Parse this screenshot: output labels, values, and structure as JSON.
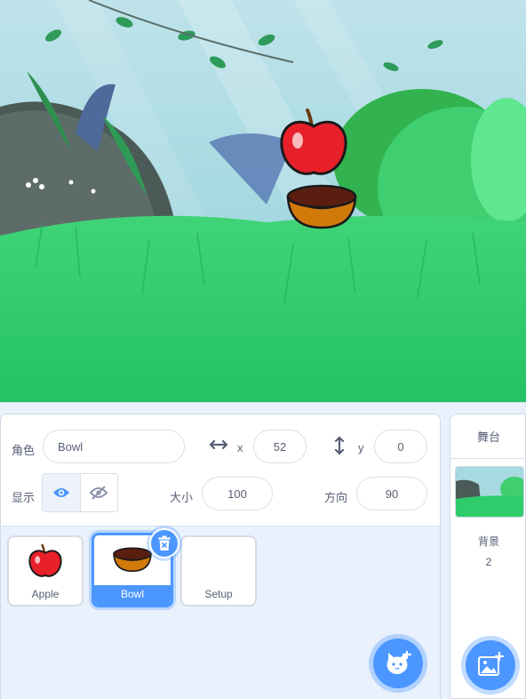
{
  "colors": {
    "accent": "#4c97ff",
    "text": "#575e75",
    "pane_bg": "#e9f1fc",
    "grass": "#2ecc6a",
    "apple_red": "#e8202a",
    "bowl_orange": "#d17a0a"
  },
  "stage": {
    "scene": "forest-grass-backdrop"
  },
  "sprite_info": {
    "sprite_label": "角色",
    "sprite_name": "Bowl",
    "x_label": "x",
    "x_value": "52",
    "y_label": "y",
    "y_value": "0",
    "show_label": "显示",
    "size_label": "大小",
    "size_value": "100",
    "direction_label": "方向",
    "direction_value": "90",
    "icons": [
      "x-arrows-icon",
      "y-arrows-icon",
      "eye-icon",
      "eye-slash-icon"
    ]
  },
  "sprites": [
    {
      "name": "Apple",
      "selected": false,
      "icon": "apple-icon"
    },
    {
      "name": "Bowl",
      "selected": true,
      "icon": "bowl-icon"
    },
    {
      "name": "Setup",
      "selected": false,
      "icon": ""
    }
  ],
  "buttons": {
    "delete_icon": "trash-icon",
    "add_sprite_icon": "cat-plus-icon",
    "add_backdrop_icon": "image-plus-icon"
  },
  "stage_pane": {
    "title": "舞台",
    "backdrops_label": "背景",
    "backdrops_count": "2"
  }
}
